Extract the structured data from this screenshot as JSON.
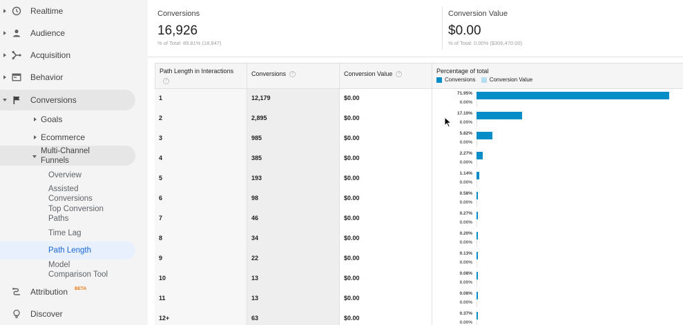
{
  "sidebar": {
    "realtime": "Realtime",
    "audience": "Audience",
    "acquisition": "Acquisition",
    "behavior": "Behavior",
    "conversions": "Conversions",
    "goals": "Goals",
    "ecommerce": "Ecommerce",
    "mcf_line1": "Multi-Channel",
    "mcf_line2": "Funnels",
    "overview": "Overview",
    "assisted_line1": "Assisted",
    "assisted_line2": "Conversions",
    "topconv_line1": "Top Conversion",
    "topconv_line2": "Paths",
    "time_lag": "Time Lag",
    "path_length": "Path Length",
    "model_line1": "Model",
    "model_line2": "Comparison Tool",
    "attribution": "Attribution",
    "beta": "BETA",
    "discover": "Discover"
  },
  "scorecards": {
    "conversions": {
      "title": "Conversions",
      "value": "16,926",
      "sub": "% of Total: 89.81% (18,847)"
    },
    "conversion_value": {
      "title": "Conversion Value",
      "value": "$0.00",
      "sub": "% of Total: 0.00% ($306,470.00)"
    }
  },
  "table": {
    "headers": {
      "path_length": "Path Length in Interactions",
      "conversions": "Conversions",
      "conversion_value": "Conversion Value",
      "percentage": "Percentage of total",
      "help": "?"
    },
    "legend": [
      {
        "label": "Conversions",
        "color": "#058dc7"
      },
      {
        "label": "Conversion Value",
        "color": "#b3def2"
      }
    ],
    "rows": [
      {
        "path": "1",
        "conversions": "12,179",
        "value": "$0.00",
        "pct": "71.95%",
        "pct_value": "0.00%",
        "share": 71.95
      },
      {
        "path": "2",
        "conversions": "2,895",
        "value": "$0.00",
        "pct": "17.10%",
        "pct_value": "0.00%",
        "share": 17.1
      },
      {
        "path": "3",
        "conversions": "985",
        "value": "$0.00",
        "pct": "5.82%",
        "pct_value": "0.00%",
        "share": 5.82
      },
      {
        "path": "4",
        "conversions": "385",
        "value": "$0.00",
        "pct": "2.27%",
        "pct_value": "0.00%",
        "share": 2.27
      },
      {
        "path": "5",
        "conversions": "193",
        "value": "$0.00",
        "pct": "1.14%",
        "pct_value": "0.00%",
        "share": 1.14
      },
      {
        "path": "6",
        "conversions": "98",
        "value": "$0.00",
        "pct": "0.58%",
        "pct_value": "0.00%",
        "share": 0.58
      },
      {
        "path": "7",
        "conversions": "46",
        "value": "$0.00",
        "pct": "0.27%",
        "pct_value": "0.00%",
        "share": 0.27
      },
      {
        "path": "8",
        "conversions": "34",
        "value": "$0.00",
        "pct": "0.20%",
        "pct_value": "0.00%",
        "share": 0.2
      },
      {
        "path": "9",
        "conversions": "22",
        "value": "$0.00",
        "pct": "0.13%",
        "pct_value": "0.00%",
        "share": 0.13
      },
      {
        "path": "10",
        "conversions": "13",
        "value": "$0.00",
        "pct": "0.08%",
        "pct_value": "0.00%",
        "share": 0.08
      },
      {
        "path": "11",
        "conversions": "13",
        "value": "$0.00",
        "pct": "0.08%",
        "pct_value": "0.00%",
        "share": 0.08
      },
      {
        "path": "12+",
        "conversions": "63",
        "value": "$0.00",
        "pct": "0.37%",
        "pct_value": "0.00%",
        "share": 0.37
      }
    ]
  },
  "colors": {
    "bar": "#058dc7",
    "active_nav": "#1967d2",
    "beta": "#e8710a"
  }
}
